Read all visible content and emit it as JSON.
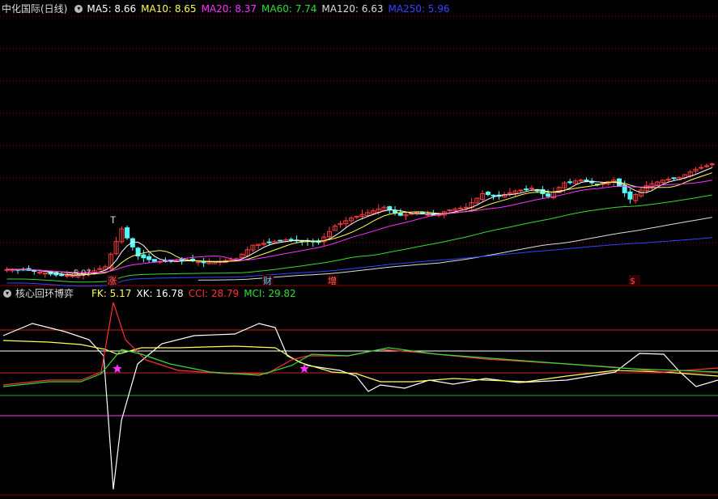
{
  "stock": {
    "title": "中化国际(日线)"
  },
  "ma_legend": [
    {
      "label": "MA5: 8.66",
      "color": "#ffffff"
    },
    {
      "label": "MA10: 8.65",
      "color": "#ffff55"
    },
    {
      "label": "MA20: 8.37",
      "color": "#ff33ff"
    },
    {
      "label": "MA60: 7.74",
      "color": "#33dd33"
    },
    {
      "label": "MA120: 6.63",
      "color": "#dddddd"
    },
    {
      "label": "MA250: 5.96",
      "color": "#3344ff"
    }
  ],
  "indicator": {
    "title": "核心回环博弈",
    "legend": [
      {
        "label": "FK: 5.17",
        "color": "#ffff55"
      },
      {
        "label": "XK: 16.78",
        "color": "#ffffff"
      },
      {
        "label": "CCI: 28.79",
        "color": "#ff3333"
      },
      {
        "label": "MCI: 29.82",
        "color": "#33dd33"
      }
    ]
  },
  "annotations": {
    "low_price": "5.07",
    "t_marker": "T",
    "events": [
      "涨",
      "财",
      "增",
      "$"
    ]
  },
  "colors": {
    "up": "#ff3c3c",
    "down": "#54ffff",
    "grid": "#8b0000",
    "star": "#ff33ff"
  },
  "chart_data": {
    "type": "candlestick",
    "ma_values": {
      "MA5": 8.66,
      "MA10": 8.65,
      "MA20": 8.37,
      "MA60": 7.74,
      "MA120": 6.63,
      "MA250": 5.96
    },
    "low": 5.07,
    "price_trend": [
      5.3,
      5.3,
      5.2,
      5.1,
      5.07,
      5.2,
      5.4,
      6.8,
      5.8,
      5.6,
      5.6,
      5.65,
      5.55,
      5.6,
      5.7,
      6.2,
      6.3,
      6.4,
      6.35,
      6.3,
      6.9,
      7.2,
      7.4,
      7.6,
      7.3,
      7.4,
      7.3,
      7.5,
      7.6,
      8.1,
      8.0,
      8.2,
      8.3,
      8.0,
      8.5,
      8.6,
      8.45,
      8.6,
      7.9,
      8.4,
      8.6,
      8.7,
      9.0,
      9.2
    ],
    "indicator_values": {
      "FK": 5.17,
      "XK": 16.78,
      "CCI": 28.79,
      "MCI": 29.82
    }
  }
}
